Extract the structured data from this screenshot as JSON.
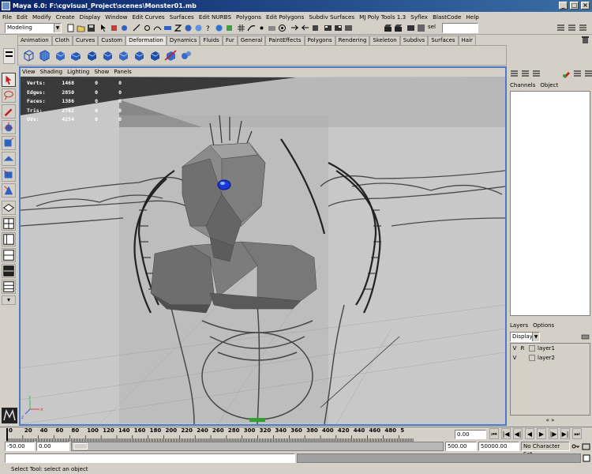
{
  "window": {
    "title": "Maya 6.0: F:\\cgvisual_Project\\scenes\\Monster01.mb"
  },
  "menu": [
    "File",
    "Edit",
    "Modify",
    "Create",
    "Display",
    "Window",
    "Edit Curves",
    "Surfaces",
    "Edit NURBS",
    "Polygons",
    "Edit Polygons",
    "Subdiv Surfaces",
    "MJ Poly Tools 1.3",
    "Syflex",
    "BlastCode",
    "Help"
  ],
  "statusline": {
    "mode": "Modeling",
    "sel_label": "sel"
  },
  "shelf_tabs": [
    "Animation",
    "Cloth",
    "Curves",
    "Custom",
    "Deformation",
    "Dynamics",
    "Fluids",
    "Fur",
    "General",
    "PaintEffects",
    "Polygons",
    "Rendering",
    "Skeleton",
    "Subdivs",
    "Surfaces",
    "Hair"
  ],
  "shelf_active": "Deformation",
  "panel_menu": [
    "View",
    "Shading",
    "Lighting",
    "Show",
    "Panels"
  ],
  "hud": [
    {
      "label": "Verts:",
      "value": "1468",
      "a": "0",
      "b": "0"
    },
    {
      "label": "Edges:",
      "value": "2850",
      "a": "0",
      "b": "0"
    },
    {
      "label": "Faces:",
      "value": "1386",
      "a": "0",
      "b": "0"
    },
    {
      "label": "Tris:",
      "value": "2762",
      "a": "0",
      "b": "0"
    },
    {
      "label": "UVs:",
      "value": "4254",
      "a": "0",
      "b": "0"
    }
  ],
  "channels": {
    "tab1": "Channels",
    "tab2": "Object"
  },
  "layers": {
    "menu1": "Layers",
    "menu2": "Options",
    "dropdown": "Display",
    "items": [
      {
        "v": "V",
        "r": "R",
        "name": "layer1"
      },
      {
        "v": "V",
        "r": "",
        "name": "layer2"
      }
    ]
  },
  "timeline": {
    "ticks": [
      "0",
      "20",
      "40",
      "60",
      "80",
      "100",
      "120",
      "140",
      "160",
      "180",
      "200",
      "220",
      "240",
      "260",
      "280",
      "300",
      "320",
      "340",
      "360",
      "380",
      "400",
      "420",
      "440",
      "460",
      "480",
      "5"
    ],
    "current": "0.00"
  },
  "range": {
    "start": "-50.00",
    "inner_start": "0.00",
    "inner_end": "500.00",
    "end": "50000.00",
    "character": "No Character Set"
  },
  "help": {
    "text": "Select Tool: select an object"
  },
  "axis": {
    "y": "y",
    "x": "x",
    "z": "z"
  }
}
